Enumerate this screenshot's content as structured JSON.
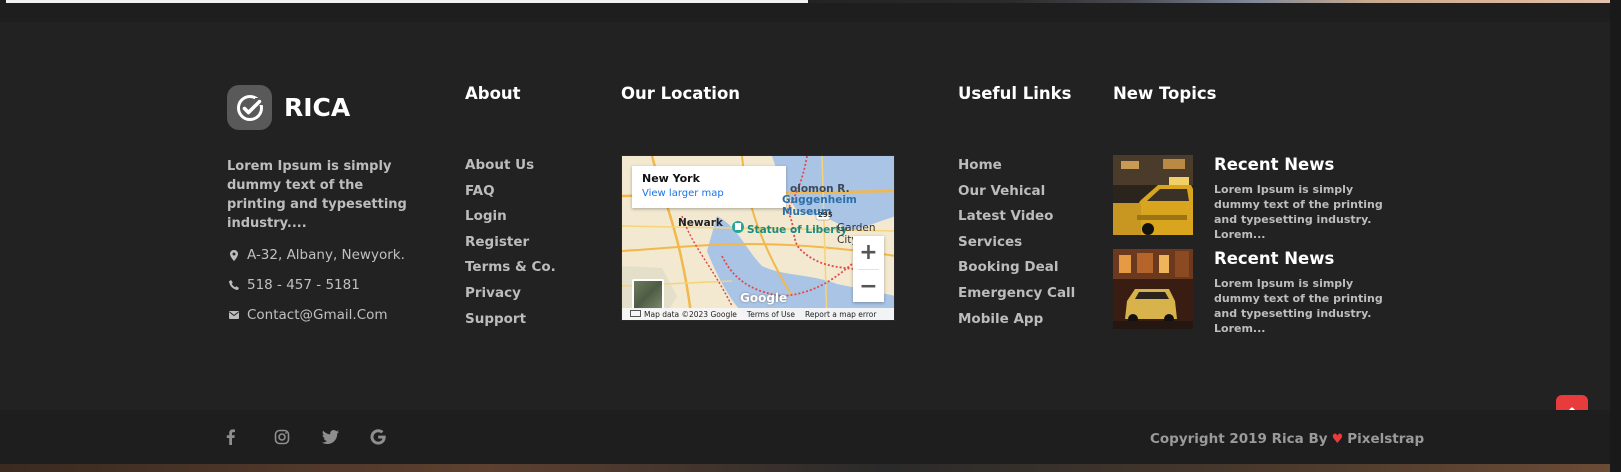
{
  "brand": {
    "name": "RICA",
    "description": "Lorem Ipsum is simply dummy text of the printing and typesetting industry....",
    "contacts": {
      "address": "A-32, Albany, Newyork.",
      "phone": "518 - 457 - 5181",
      "email": "Contact@Gmail.Com"
    }
  },
  "about": {
    "title": "About",
    "links": [
      "About Us",
      "FAQ",
      "Login",
      "Register",
      "Terms & Co.",
      "Privacy",
      "Support"
    ]
  },
  "location": {
    "title": "Our Location",
    "map": {
      "place": "New York",
      "larger_map": "View larger map",
      "labels": {
        "newark": "Newark",
        "statue": "Statue of Liberty",
        "garden": "Garden City",
        "museum": "Guggenheim Museum",
        "solomon": "olomon R.",
        "route": "295"
      },
      "zoom_in": "+",
      "zoom_out": "−",
      "google": "Google",
      "footer": [
        "Map data ©2023 Google",
        "Terms of Use",
        "Report a map error"
      ]
    }
  },
  "useful": {
    "title": "Useful Links",
    "links": [
      "Home",
      "Our Vehical",
      "Latest Video",
      "Services",
      "Booking Deal",
      "Emergency Call",
      "Mobile App"
    ]
  },
  "topics": {
    "title": "New Topics",
    "items": [
      {
        "title": "Recent News",
        "body": "Lorem Ipsum is simply dummy text of the printing and typesetting industry. Lorem..."
      },
      {
        "title": "Recent News",
        "body": "Lorem Ipsum is simply dummy text of the printing and typesetting industry. Lorem..."
      }
    ]
  },
  "social": [
    "facebook-icon",
    "instagram-icon",
    "twitter-icon",
    "google-icon"
  ],
  "copyright": {
    "prefix": "Copyright 2019 Rica By",
    "suffix": "Pixelstrap"
  },
  "colors": {
    "background": "#222222",
    "accent": "#e73c3b",
    "muted_text": "#bdbdbd"
  }
}
